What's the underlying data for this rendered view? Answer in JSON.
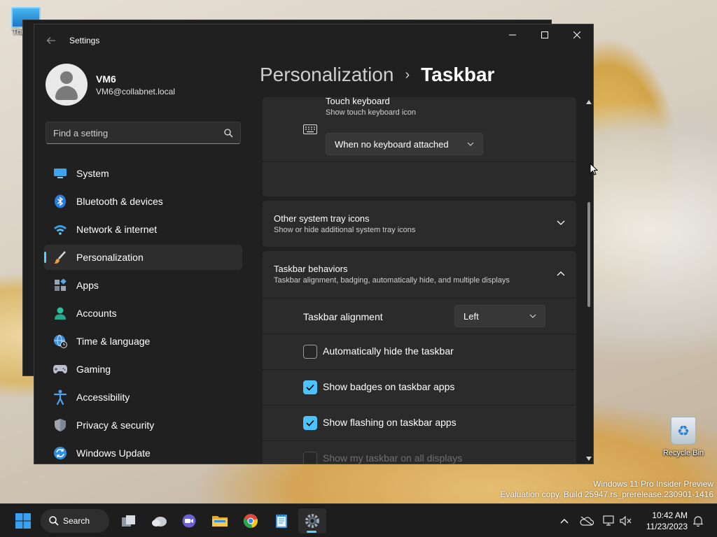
{
  "desktop": {
    "icons": [
      {
        "label": "This PC"
      },
      {
        "label": "Recycle Bin"
      }
    ],
    "watermark": {
      "line1": "Windows 11 Pro Insider Preview",
      "line2": "Evaluation copy. Build 25947.rs_prerelease.230901-1416"
    }
  },
  "window": {
    "title": "Settings",
    "controls": {
      "minimize": "—",
      "maximize": "☐",
      "close": "✕"
    }
  },
  "profile": {
    "name": "VM6",
    "email": "VM6@collabnet.local"
  },
  "search": {
    "placeholder": "Find a setting"
  },
  "nav": {
    "items": [
      {
        "label": "System",
        "icon": "system-icon"
      },
      {
        "label": "Bluetooth & devices",
        "icon": "bluetooth-icon"
      },
      {
        "label": "Network & internet",
        "icon": "wifi-icon"
      },
      {
        "label": "Personalization",
        "icon": "brush-icon",
        "active": true
      },
      {
        "label": "Apps",
        "icon": "apps-icon"
      },
      {
        "label": "Accounts",
        "icon": "accounts-icon"
      },
      {
        "label": "Time & language",
        "icon": "globe-clock-icon"
      },
      {
        "label": "Gaming",
        "icon": "gamepad-icon"
      },
      {
        "label": "Accessibility",
        "icon": "accessibility-icon"
      },
      {
        "label": "Privacy & security",
        "icon": "shield-icon"
      },
      {
        "label": "Windows Update",
        "icon": "update-icon"
      }
    ]
  },
  "breadcrumb": {
    "parent": "Personalization",
    "separator": "›",
    "current": "Taskbar"
  },
  "touch_keyboard": {
    "title": "Touch keyboard",
    "subtitle": "Show touch keyboard icon",
    "value": "When no keyboard attached"
  },
  "other_tray": {
    "title": "Other system tray icons",
    "subtitle": "Show or hide additional system tray icons"
  },
  "behaviors": {
    "title": "Taskbar behaviors",
    "subtitle": "Taskbar alignment, badging, automatically hide, and multiple displays",
    "alignment_label": "Taskbar alignment",
    "alignment_value": "Left",
    "options": [
      {
        "label": "Automatically hide the taskbar",
        "checked": false,
        "disabled": false
      },
      {
        "label": "Show badges on taskbar apps",
        "checked": true,
        "disabled": false
      },
      {
        "label": "Show flashing on taskbar apps",
        "checked": true,
        "disabled": false
      },
      {
        "label": "Show my taskbar on all displays",
        "checked": false,
        "disabled": true
      }
    ]
  },
  "taskbar": {
    "search_label": "Search",
    "clock_time": "10:42 AM",
    "clock_date": "11/23/2023",
    "apps": [
      "start-icon",
      "task-view-icon",
      "weather-icon",
      "meet-icon",
      "file-explorer-icon",
      "chrome-icon",
      "notepad-icon",
      "settings-icon"
    ]
  },
  "colors": {
    "accent": "#60cdff",
    "checkbox": "#4cc2ff",
    "window_bg": "#202020",
    "card_bg": "#2b2b2b"
  }
}
